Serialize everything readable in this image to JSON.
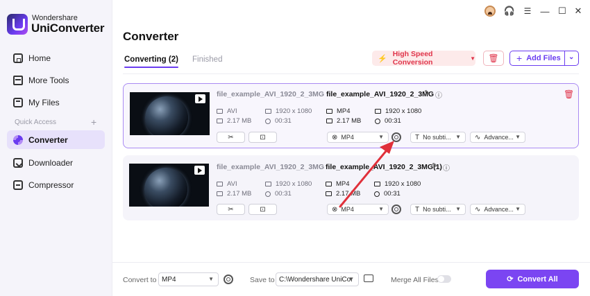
{
  "app": {
    "brand_small": "Wondershare",
    "brand_big": "UniConverter"
  },
  "sidebar": {
    "items": [
      {
        "label": "Home",
        "icon": "home-icon"
      },
      {
        "label": "More Tools",
        "icon": "tools-icon"
      },
      {
        "label": "My Files",
        "icon": "files-icon"
      },
      {
        "label": "Converter",
        "icon": "converter-icon",
        "active": true
      },
      {
        "label": "Downloader",
        "icon": "download-icon"
      },
      {
        "label": "Compressor",
        "icon": "compress-icon"
      }
    ],
    "quick_access": "Quick Access",
    "quick_access_add": "+"
  },
  "window": {
    "headset": "🎧",
    "menu": "☰",
    "minimize": "—",
    "maximize": "☐",
    "close": "✕"
  },
  "header": {
    "title": "Converter",
    "tabs": [
      {
        "label": "Converting (2)"
      },
      {
        "label": "Finished"
      }
    ],
    "high_speed": "High Speed Conversion",
    "high_speed_icon": "⚡",
    "add_files": "Add Files",
    "accent": "#6a3cf0",
    "danger": "#e0344a"
  },
  "files": [
    {
      "source_name": "file_example_AVI_1920_2_3MG",
      "source_format": "AVI",
      "source_resolution": "1920 x 1080",
      "source_size": "2.17 MB",
      "source_duration": "00:31",
      "target_name": "file_example_AVI_1920_2_3MG",
      "target_format": "MP4",
      "target_resolution": "1920 x 1080",
      "target_size": "2.17 MB",
      "target_duration": "00:31",
      "format_select": "MP4",
      "subtitle_select": "No subti...",
      "audio_select": "Advance...",
      "selected": true
    },
    {
      "source_name": "file_example_AVI_1920_2_3MG",
      "source_format": "AVI",
      "source_resolution": "1920 x 1080",
      "source_size": "2.17 MB",
      "source_duration": "00:31",
      "target_name": "file_example_AVI_1920_2_3MG(1)",
      "target_format": "MP4",
      "target_resolution": "1920 x 1080",
      "target_size": "2.17 MB",
      "target_duration": "00:31",
      "format_select": "MP4",
      "subtitle_select": "No subti...",
      "audio_select": "Advance...",
      "selected": false
    }
  ],
  "footer": {
    "convert_to_label": "Convert to",
    "convert_to_value": "MP4",
    "save_to_label": "Save to",
    "save_to_value": "C:\\Wondershare UniCor",
    "merge_label": "Merge All Files",
    "merge_on": false,
    "convert_all": "Convert All"
  },
  "annotation": {
    "arrow_color": "#e0303a"
  }
}
